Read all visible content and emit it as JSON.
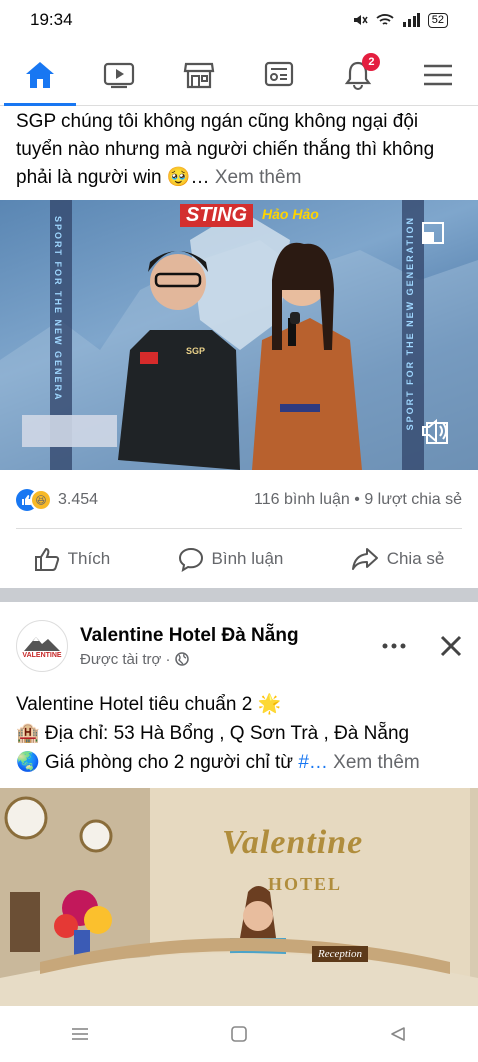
{
  "status_bar": {
    "time": "19:34",
    "battery": "52"
  },
  "nav": {
    "items": [
      {
        "icon": "home-icon",
        "active": true
      },
      {
        "icon": "watch-icon",
        "active": false
      },
      {
        "icon": "marketplace-icon",
        "active": false
      },
      {
        "icon": "news-icon",
        "active": false
      },
      {
        "icon": "notifications-icon",
        "active": false,
        "badge": "2"
      },
      {
        "icon": "menu-icon",
        "active": false
      }
    ],
    "accent": "#1877f2"
  },
  "post": {
    "text": "SGP chúng tôi không ngán cũng không ngại đội tuyển nào nhưng mà người chiến thắng thì không phải là người win 🥹…",
    "see_more": "Xem thêm",
    "video": {
      "sponsor_left": "STING",
      "sponsor_right": "Hảo Hảo",
      "side_text_left": "SPORT FOR THE NEW GENERA",
      "side_text_right": "SPORT FOR THE NEW GENERATION",
      "jersey_text": "SGP"
    },
    "reactions_count": "3.454",
    "comments": "116 bình luận",
    "shares": "9 lượt chia sẻ",
    "actions": {
      "like": "Thích",
      "comment": "Bình luận",
      "share": "Chia sẻ"
    }
  },
  "ad": {
    "page_name": "Valentine Hotel Đà Nẵng",
    "sponsored": "Được tài trợ ·",
    "logo_text": "VALENTINE",
    "line1": "Valentine Hotel tiêu chuẩn 2 🌟",
    "line2": "🏨 Địa chỉ: 53 Hà Bổng , Q Sơn Trà , Đà Nẵng",
    "line3_start": "🌏 Giá phòng cho 2 người chỉ từ ",
    "line3_link": "#…",
    "see_more": "Xem thêm",
    "photo": {
      "sign_main": "Valentine",
      "sign_sub": "HOTEL",
      "desk_sign": "Reception"
    }
  }
}
